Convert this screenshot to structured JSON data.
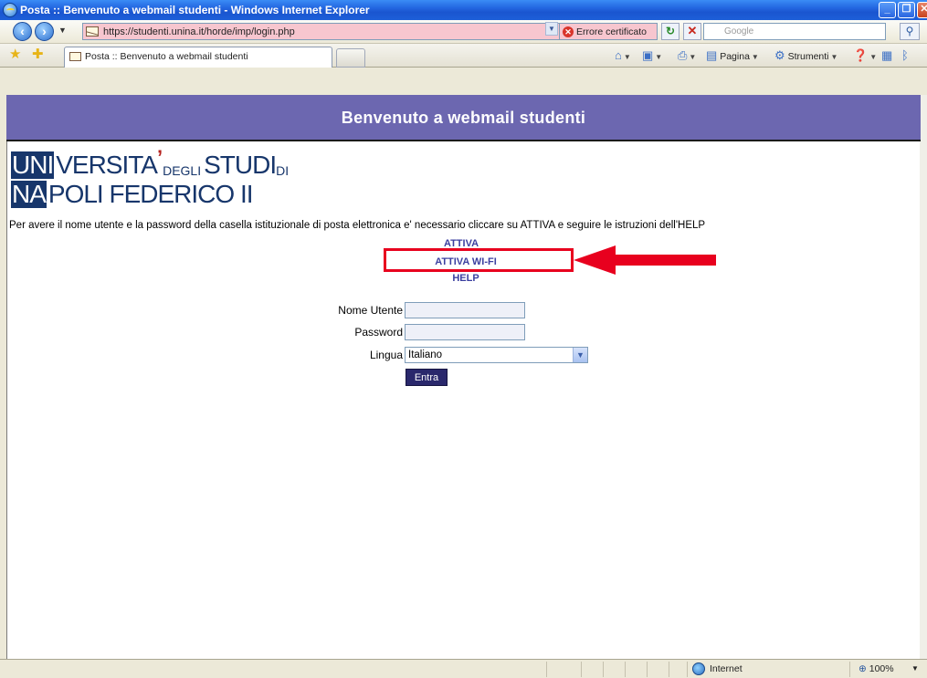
{
  "window": {
    "title": "Posta :: Benvenuto a webmail studenti - Windows Internet Explorer"
  },
  "toolbar": {
    "address": "https://studenti.unina.it/horde/imp/login.php",
    "cert_error": "Errore certificato",
    "search_placeholder": "Google"
  },
  "tabs": [
    {
      "label": "Posta :: Benvenuto a webmail studenti"
    }
  ],
  "commands": {
    "page": "Pagina",
    "tools": "Strumenti"
  },
  "page": {
    "header": "Benvenuto a webmail studenti",
    "logo": {
      "line1_block": "UNI",
      "line1_text": "VERSITA",
      "line1_small": "DEGLI",
      "line1_text2": "STUDI",
      "line1_small2": "DI",
      "line2_block": "NA",
      "line2_text": "POLI FEDERICO II"
    },
    "info": "Per avere il nome utente e la password della casella istituzionale di posta elettronica e' necessario cliccare su ATTIVA e seguire le istruzioni dell'HELP",
    "links": {
      "attiva": "ATTIVA",
      "wifi": "ATTIVA WI-FI",
      "help": "HELP"
    },
    "form": {
      "username_label": "Nome Utente",
      "password_label": "Password",
      "language_label": "Lingua",
      "language_value": "Italiano",
      "submit_label": "Entra"
    },
    "annotation_color": "#e8001e"
  },
  "statusbar": {
    "zone": "Internet",
    "zoom": "100%"
  }
}
